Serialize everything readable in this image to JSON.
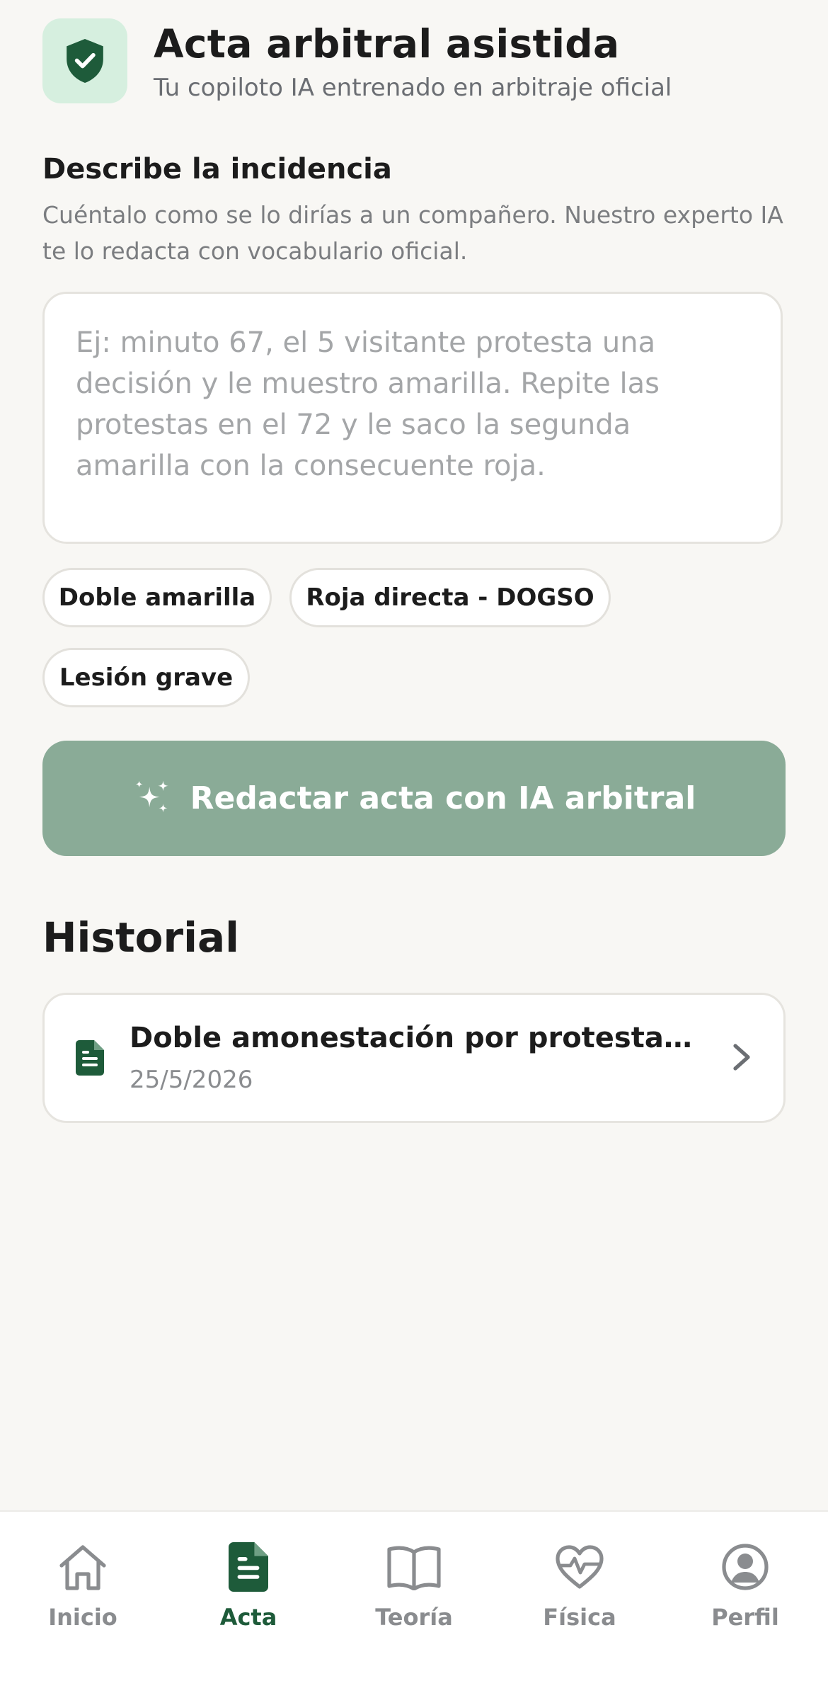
{
  "header": {
    "title": "Acta arbitral asistida",
    "subtitle": "Tu copiloto IA entrenado en arbitraje oficial",
    "badge_icon": "shield-check-icon"
  },
  "incident": {
    "title": "Describe la incidencia",
    "help": "Cuéntalo como se lo dirías a un compañero. Nuestro experto IA te lo redacta con vocabulario oficial.",
    "value": "",
    "placeholder": "Ej: minuto 67, el 5 visitante protesta una decisión y le muestro amarilla. Repite las protestas en el 72 y le saco la segunda amarilla con la consecuente roja."
  },
  "chips": [
    {
      "label": "Doble amarilla"
    },
    {
      "label": "Roja directa - DOGSO"
    },
    {
      "label": "Lesión grave"
    }
  ],
  "generate_button": {
    "label": "Redactar acta con IA arbitral",
    "icon": "sparkles-icon"
  },
  "history": {
    "title": "Historial",
    "items": [
      {
        "title": "Doble amonestación por protestas reiteradas",
        "date": "25/5/2026",
        "icon": "document-icon"
      }
    ]
  },
  "nav": {
    "items": [
      {
        "label": "Inicio",
        "icon": "home-icon",
        "active": false
      },
      {
        "label": "Acta",
        "icon": "document-icon",
        "active": true
      },
      {
        "label": "Teoría",
        "icon": "book-icon",
        "active": false
      },
      {
        "label": "Física",
        "icon": "heart-pulse-icon",
        "active": false
      },
      {
        "label": "Perfil",
        "icon": "user-circle-icon",
        "active": false
      }
    ]
  },
  "colors": {
    "background": "#f8f7f4",
    "accent": "#1e5b3a",
    "badge_bg": "#d6efdf",
    "button_bg": "#8aab97",
    "muted_text": "#8a8c8f"
  }
}
